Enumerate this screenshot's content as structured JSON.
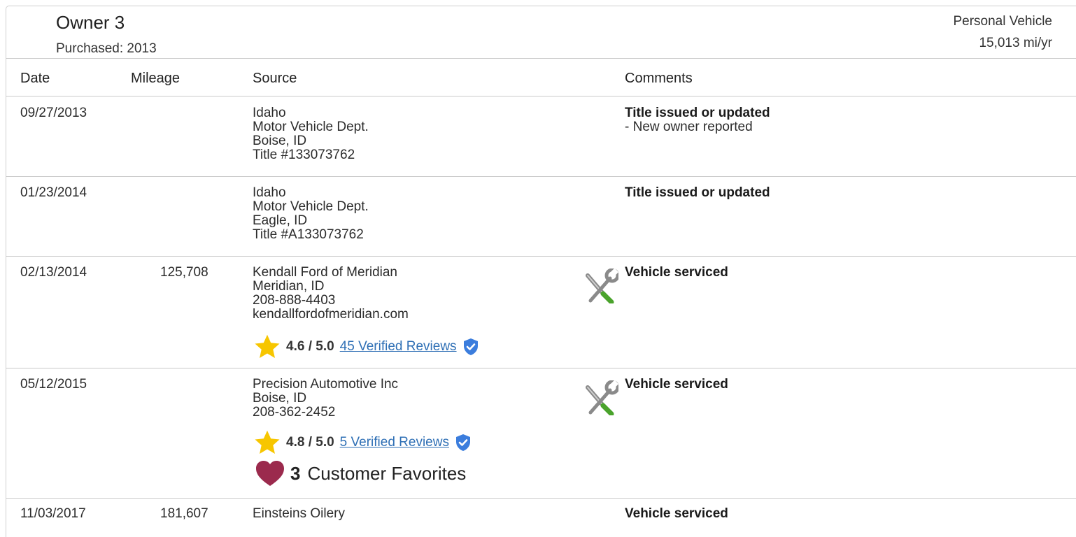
{
  "owner": {
    "title": "Owner 3",
    "purchased": "Purchased: 2013",
    "vehicle_type": "Personal Vehicle",
    "miles_per_year": "15,013 mi/yr"
  },
  "table": {
    "headers": [
      "Date",
      "Mileage",
      "Source",
      "Comments"
    ],
    "rows": [
      {
        "date": "09/27/2013",
        "mileage": "",
        "source": [
          "Idaho",
          "Motor Vehicle Dept.",
          "Boise, ID",
          "Title #133073762"
        ],
        "comment_title": "Title issued or updated",
        "comment_detail": "- New owner reported"
      },
      {
        "date": "01/23/2014",
        "mileage": "",
        "source": [
          "Idaho",
          "Motor Vehicle Dept.",
          "Eagle, ID",
          "Title #A133073762"
        ],
        "comment_title": "Title issued or updated"
      },
      {
        "date": "02/13/2014",
        "mileage": "125,708",
        "source": [
          "Kendall Ford of Meridian",
          "Meridian, ID",
          "208-888-4403",
          "kendallfordofmeridian.com"
        ],
        "rating": "4.6 / 5.0",
        "reviews": "45 Verified Reviews",
        "comment_title": "Vehicle serviced"
      },
      {
        "date": "05/12/2015",
        "mileage": "",
        "source": [
          "Precision Automotive Inc",
          "Boise, ID",
          "208-362-2452"
        ],
        "rating": "4.8 / 5.0",
        "reviews": "5 Verified Reviews",
        "favorites_count": "3",
        "favorites_label": "Customer Favorites",
        "comment_title": "Vehicle serviced"
      },
      {
        "date": "11/03/2017",
        "mileage": "181,607",
        "source": [
          "Einsteins Oilery"
        ],
        "comment_title": "Vehicle serviced"
      }
    ]
  },
  "icons": {
    "service": "wrench-screwdriver-icon",
    "rating": "star-icon",
    "verified": "verified-shield-icon",
    "favorite": "heart-icon"
  },
  "colors": {
    "star": "#f7c600",
    "verified": "#3b7ddd",
    "heart": "#9b2a4d",
    "link": "#2e6fb5"
  }
}
